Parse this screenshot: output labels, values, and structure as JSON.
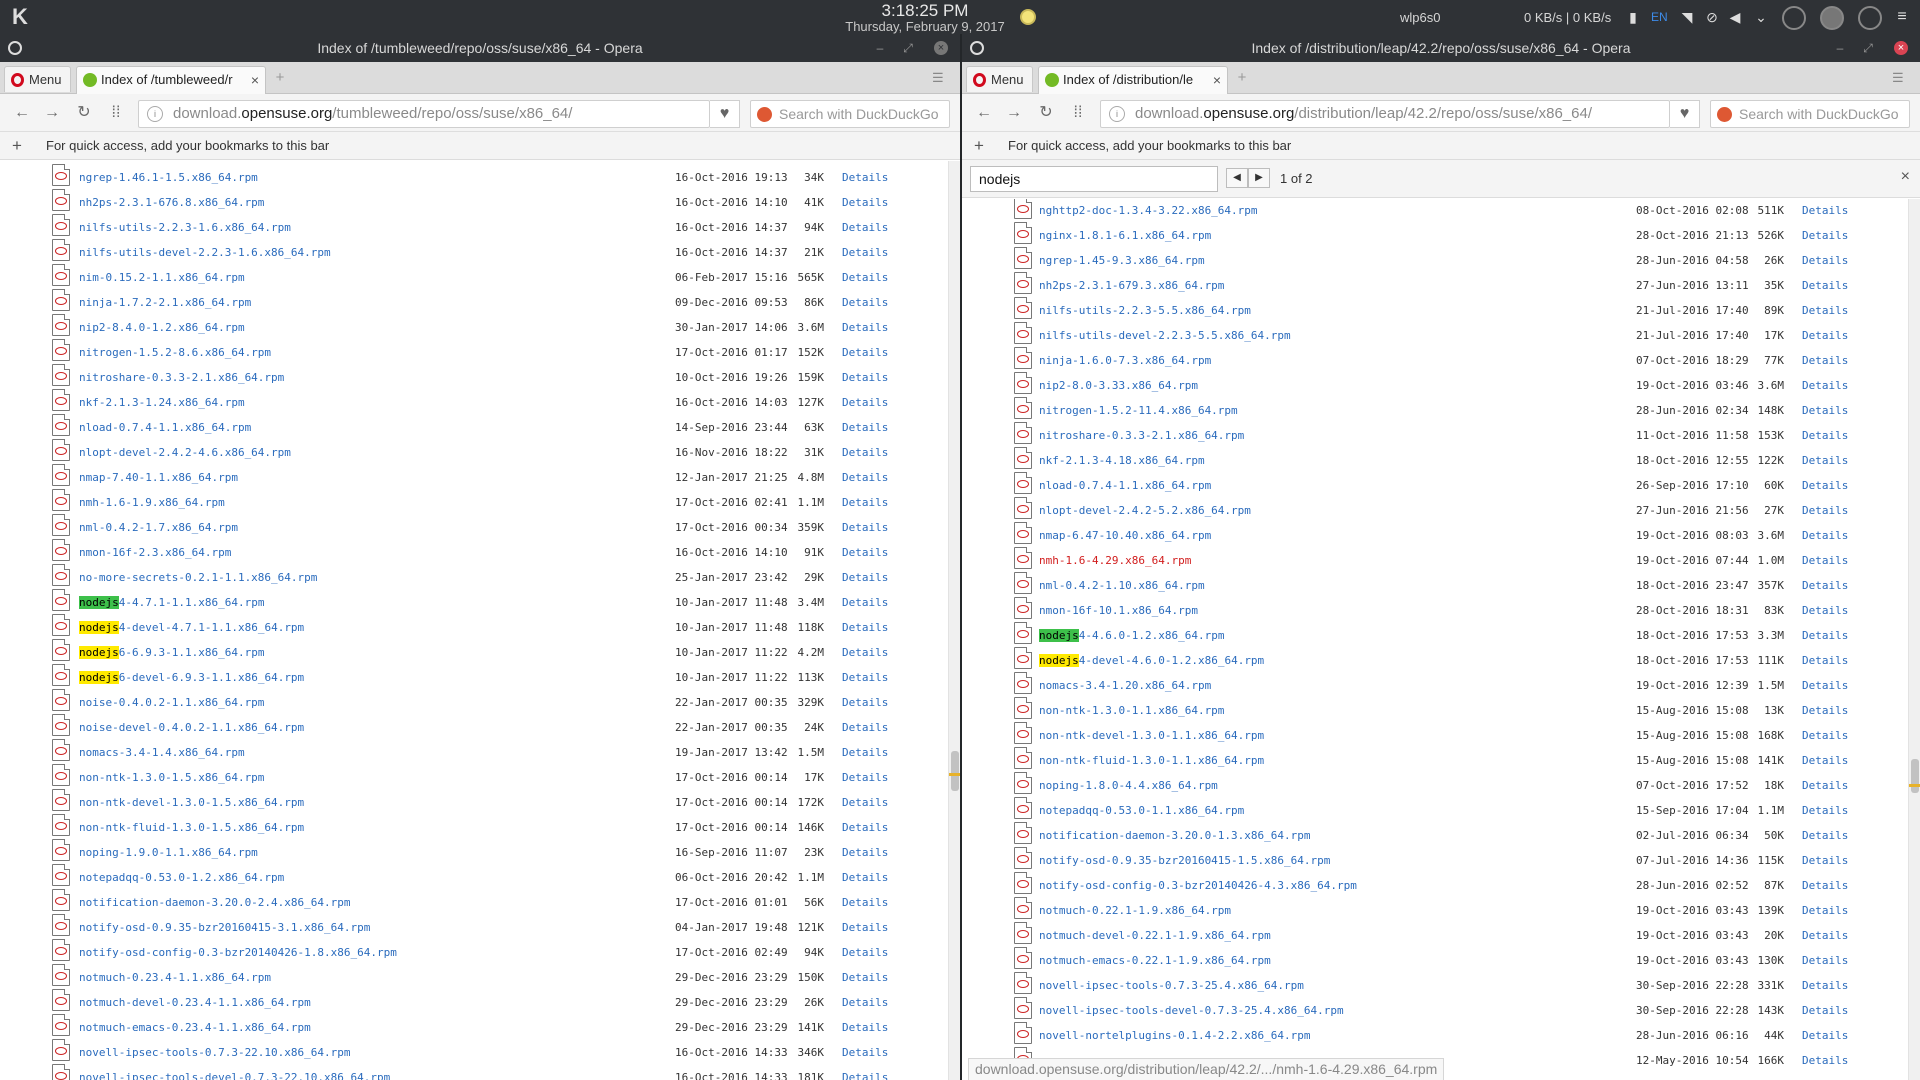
{
  "taskbar": {
    "time": "3:18:25 PM",
    "date": "Thursday, February 9, 2017",
    "network_name": "wlp6s0",
    "net_speed": "0 KB/s | 0 KB/s",
    "keyboard_layout": "EN",
    "icons": [
      "kde-launcher-icon",
      "weather-sun-icon",
      "battery-icon",
      "wifi-icon",
      "clip-icon",
      "volume-icon",
      "chevron-down-icon",
      "power-icon",
      "session-icon",
      "circle-icon",
      "hamburger-icon"
    ]
  },
  "left_window": {
    "title": "Index of /tumbleweed/repo/oss/suse/x86_64 - Opera",
    "menu_label": "Menu",
    "tab_label": "Index of /tumbleweed/r",
    "url_prefix": "download.",
    "url_domain": "opensuse.org",
    "url_path": "/tumbleweed/repo/oss/suse/x86_64/",
    "search_placeholder": "Search with DuckDuckGo",
    "bookmarks_hint": "For quick access, add your bookmarks to this bar",
    "details_label": "Details",
    "files": [
      {
        "name": "ngrep-1.46.1-1.5.x86_64.rpm",
        "date": "16-Oct-2016 19:13",
        "size": "34K"
      },
      {
        "name": "nh2ps-2.3.1-676.8.x86_64.rpm",
        "date": "16-Oct-2016 14:10",
        "size": "41K"
      },
      {
        "name": "nilfs-utils-2.2.3-1.6.x86_64.rpm",
        "date": "16-Oct-2016 14:37",
        "size": "94K"
      },
      {
        "name": "nilfs-utils-devel-2.2.3-1.6.x86_64.rpm",
        "date": "16-Oct-2016 14:37",
        "size": "21K"
      },
      {
        "name": "nim-0.15.2-1.1.x86_64.rpm",
        "date": "06-Feb-2017 15:16",
        "size": "565K"
      },
      {
        "name": "ninja-1.7.2-2.1.x86_64.rpm",
        "date": "09-Dec-2016 09:53",
        "size": "86K"
      },
      {
        "name": "nip2-8.4.0-1.2.x86_64.rpm",
        "date": "30-Jan-2017 14:06",
        "size": "3.6M"
      },
      {
        "name": "nitrogen-1.5.2-8.6.x86_64.rpm",
        "date": "17-Oct-2016 01:17",
        "size": "152K"
      },
      {
        "name": "nitroshare-0.3.3-2.1.x86_64.rpm",
        "date": "10-Oct-2016 19:26",
        "size": "159K"
      },
      {
        "name": "nkf-2.1.3-1.24.x86_64.rpm",
        "date": "16-Oct-2016 14:03",
        "size": "127K"
      },
      {
        "name": "nload-0.7.4-1.1.x86_64.rpm",
        "date": "14-Sep-2016 23:44",
        "size": "63K"
      },
      {
        "name": "nlopt-devel-2.4.2-4.6.x86_64.rpm",
        "date": "16-Nov-2016 18:22",
        "size": "31K"
      },
      {
        "name": "nmap-7.40-1.1.x86_64.rpm",
        "date": "12-Jan-2017 21:25",
        "size": "4.8M"
      },
      {
        "name": "nmh-1.6-1.9.x86_64.rpm",
        "date": "17-Oct-2016 02:41",
        "size": "1.1M"
      },
      {
        "name": "nml-0.4.2-1.7.x86_64.rpm",
        "date": "17-Oct-2016 00:34",
        "size": "359K"
      },
      {
        "name": "nmon-16f-2.3.x86_64.rpm",
        "date": "16-Oct-2016 14:10",
        "size": "91K"
      },
      {
        "name": "no-more-secrets-0.2.1-1.1.x86_64.rpm",
        "date": "25-Jan-2017 23:42",
        "size": "29K"
      },
      {
        "hl": "nodejs",
        "name": "4-4.7.1-1.1.x86_64.rpm",
        "active": true,
        "date": "10-Jan-2017 11:48",
        "size": "3.4M"
      },
      {
        "hl": "nodejs",
        "name": "4-devel-4.7.1-1.1.x86_64.rpm",
        "date": "10-Jan-2017 11:48",
        "size": "118K"
      },
      {
        "hl": "nodejs",
        "name": "6-6.9.3-1.1.x86_64.rpm",
        "date": "10-Jan-2017 11:22",
        "size": "4.2M"
      },
      {
        "hl": "nodejs",
        "name": "6-devel-6.9.3-1.1.x86_64.rpm",
        "date": "10-Jan-2017 11:22",
        "size": "113K"
      },
      {
        "name": "noise-0.4.0.2-1.1.x86_64.rpm",
        "date": "22-Jan-2017 00:35",
        "size": "329K"
      },
      {
        "name": "noise-devel-0.4.0.2-1.1.x86_64.rpm",
        "date": "22-Jan-2017 00:35",
        "size": "24K"
      },
      {
        "name": "nomacs-3.4-1.4.x86_64.rpm",
        "date": "19-Jan-2017 13:42",
        "size": "1.5M"
      },
      {
        "name": "non-ntk-1.3.0-1.5.x86_64.rpm",
        "date": "17-Oct-2016 00:14",
        "size": "17K"
      },
      {
        "name": "non-ntk-devel-1.3.0-1.5.x86_64.rpm",
        "date": "17-Oct-2016 00:14",
        "size": "172K"
      },
      {
        "name": "non-ntk-fluid-1.3.0-1.5.x86_64.rpm",
        "date": "17-Oct-2016 00:14",
        "size": "146K"
      },
      {
        "name": "noping-1.9.0-1.1.x86_64.rpm",
        "date": "16-Sep-2016 11:07",
        "size": "23K"
      },
      {
        "name": "notepadqq-0.53.0-1.2.x86_64.rpm",
        "date": "06-Oct-2016 20:42",
        "size": "1.1M"
      },
      {
        "name": "notification-daemon-3.20.0-2.4.x86_64.rpm",
        "date": "17-Oct-2016 01:01",
        "size": "56K"
      },
      {
        "name": "notify-osd-0.9.35-bzr20160415-3.1.x86_64.rpm",
        "date": "04-Jan-2017 19:48",
        "size": "121K"
      },
      {
        "name": "notify-osd-config-0.3-bzr20140426-1.8.x86_64.rpm",
        "date": "17-Oct-2016 02:49",
        "size": "94K"
      },
      {
        "name": "notmuch-0.23.4-1.1.x86_64.rpm",
        "date": "29-Dec-2016 23:29",
        "size": "150K"
      },
      {
        "name": "notmuch-devel-0.23.4-1.1.x86_64.rpm",
        "date": "29-Dec-2016 23:29",
        "size": "26K"
      },
      {
        "name": "notmuch-emacs-0.23.4-1.1.x86_64.rpm",
        "date": "29-Dec-2016 23:29",
        "size": "141K"
      },
      {
        "name": "novell-ipsec-tools-0.7.3-22.10.x86_64.rpm",
        "date": "16-Oct-2016 14:33",
        "size": "346K"
      },
      {
        "name": "novell-ipsec-tools-devel-0.7.3-22.10.x86_64.rpm",
        "date": "16-Oct-2016 14:33",
        "size": "181K"
      }
    ]
  },
  "right_window": {
    "title": "Index of /distribution/leap/42.2/repo/oss/suse/x86_64 - Opera",
    "menu_label": "Menu",
    "tab_label": "Index of /distribution/le",
    "url_prefix": "download.",
    "url_domain": "opensuse.org",
    "url_path": "/distribution/leap/42.2/repo/oss/suse/x86_64/",
    "search_placeholder": "Search with DuckDuckGo",
    "bookmarks_hint": "For quick access, add your bookmarks to this bar",
    "find_query": "nodejs",
    "find_count": "1 of 2",
    "details_label": "Details",
    "status_url": "download.opensuse.org/distribution/leap/42.2/.../nmh-1.6-4.29.x86_64.rpm",
    "files": [
      {
        "name": "nghttp2-doc-1.3.4-3.22.x86_64.rpm",
        "date": "08-Oct-2016 02:08",
        "size": "511K"
      },
      {
        "name": "nginx-1.8.1-6.1.x86_64.rpm",
        "date": "28-Oct-2016 21:13",
        "size": "526K"
      },
      {
        "name": "ngrep-1.45-9.3.x86_64.rpm",
        "date": "28-Jun-2016 04:58",
        "size": "26K"
      },
      {
        "name": "nh2ps-2.3.1-679.3.x86_64.rpm",
        "date": "27-Jun-2016 13:11",
        "size": "35K"
      },
      {
        "name": "nilfs-utils-2.2.3-5.5.x86_64.rpm",
        "date": "21-Jul-2016 17:40",
        "size": "89K"
      },
      {
        "name": "nilfs-utils-devel-2.2.3-5.5.x86_64.rpm",
        "date": "21-Jul-2016 17:40",
        "size": "17K"
      },
      {
        "name": "ninja-1.6.0-7.3.x86_64.rpm",
        "date": "07-Oct-2016 18:29",
        "size": "77K"
      },
      {
        "name": "nip2-8.0-3.33.x86_64.rpm",
        "date": "19-Oct-2016 03:46",
        "size": "3.6M"
      },
      {
        "name": "nitrogen-1.5.2-11.4.x86_64.rpm",
        "date": "28-Jun-2016 02:34",
        "size": "148K"
      },
      {
        "name": "nitroshare-0.3.3-2.1.x86_64.rpm",
        "date": "11-Oct-2016 11:58",
        "size": "153K"
      },
      {
        "name": "nkf-2.1.3-4.18.x86_64.rpm",
        "date": "18-Oct-2016 12:55",
        "size": "122K"
      },
      {
        "name": "nload-0.7.4-1.1.x86_64.rpm",
        "date": "26-Sep-2016 17:10",
        "size": "60K"
      },
      {
        "name": "nlopt-devel-2.4.2-5.2.x86_64.rpm",
        "date": "27-Jun-2016 21:56",
        "size": "27K"
      },
      {
        "name": "nmap-6.47-10.40.x86_64.rpm",
        "date": "19-Oct-2016 08:03",
        "size": "3.6M"
      },
      {
        "name": "nmh-1.6-4.29.x86_64.rpm",
        "visited": true,
        "date": "19-Oct-2016 07:44",
        "size": "1.0M"
      },
      {
        "name": "nml-0.4.2-1.10.x86_64.rpm",
        "date": "18-Oct-2016 23:47",
        "size": "357K"
      },
      {
        "name": "nmon-16f-10.1.x86_64.rpm",
        "date": "28-Oct-2016 18:31",
        "size": "83K"
      },
      {
        "hl": "nodejs",
        "name": "4-4.6.0-1.2.x86_64.rpm",
        "active": true,
        "date": "18-Oct-2016 17:53",
        "size": "3.3M"
      },
      {
        "hl": "nodejs",
        "name": "4-devel-4.6.0-1.2.x86_64.rpm",
        "date": "18-Oct-2016 17:53",
        "size": "111K"
      },
      {
        "name": "nomacs-3.4-1.20.x86_64.rpm",
        "date": "19-Oct-2016 12:39",
        "size": "1.5M"
      },
      {
        "name": "non-ntk-1.3.0-1.1.x86_64.rpm",
        "date": "15-Aug-2016 15:08",
        "size": "13K"
      },
      {
        "name": "non-ntk-devel-1.3.0-1.1.x86_64.rpm",
        "date": "15-Aug-2016 15:08",
        "size": "168K"
      },
      {
        "name": "non-ntk-fluid-1.3.0-1.1.x86_64.rpm",
        "date": "15-Aug-2016 15:08",
        "size": "141K"
      },
      {
        "name": "noping-1.8.0-4.4.x86_64.rpm",
        "date": "07-Oct-2016 17:52",
        "size": "18K"
      },
      {
        "name": "notepadqq-0.53.0-1.1.x86_64.rpm",
        "date": "15-Sep-2016 17:04",
        "size": "1.1M"
      },
      {
        "name": "notification-daemon-3.20.0-1.3.x86_64.rpm",
        "date": "02-Jul-2016 06:34",
        "size": "50K"
      },
      {
        "name": "notify-osd-0.9.35-bzr20160415-1.5.x86_64.rpm",
        "date": "07-Jul-2016 14:36",
        "size": "115K"
      },
      {
        "name": "notify-osd-config-0.3-bzr20140426-4.3.x86_64.rpm",
        "date": "28-Jun-2016 02:52",
        "size": "87K"
      },
      {
        "name": "notmuch-0.22.1-1.9.x86_64.rpm",
        "date": "19-Oct-2016 03:43",
        "size": "139K"
      },
      {
        "name": "notmuch-devel-0.22.1-1.9.x86_64.rpm",
        "date": "19-Oct-2016 03:43",
        "size": "20K"
      },
      {
        "name": "notmuch-emacs-0.22.1-1.9.x86_64.rpm",
        "date": "19-Oct-2016 03:43",
        "size": "130K"
      },
      {
        "name": "novell-ipsec-tools-0.7.3-25.4.x86_64.rpm",
        "date": "30-Sep-2016 22:28",
        "size": "331K"
      },
      {
        "name": "novell-ipsec-tools-devel-0.7.3-25.4.x86_64.rpm",
        "date": "30-Sep-2016 22:28",
        "size": "143K"
      },
      {
        "name": "novell-nortelplugins-0.1.4-2.2.x86_64.rpm",
        "date": "28-Jun-2016 06:16",
        "size": "44K"
      },
      {
        "name": "",
        "date": "12-May-2016 10:54",
        "size": "166K"
      }
    ]
  }
}
